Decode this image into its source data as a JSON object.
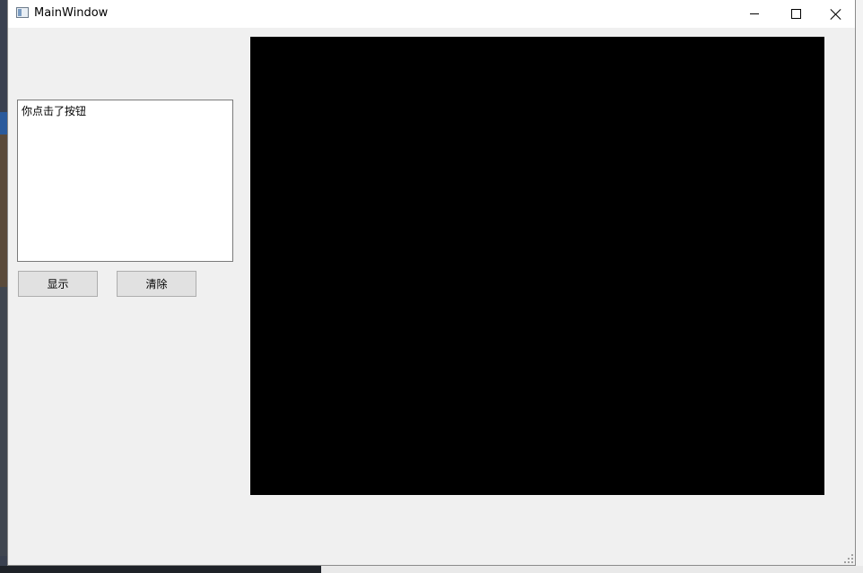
{
  "window": {
    "title": "MainWindow",
    "icon": "app-window-icon"
  },
  "caption_buttons": {
    "minimize": "minimize-icon",
    "maximize": "maximize-icon",
    "close": "close-icon"
  },
  "textbox": {
    "content": "你点击了按钮"
  },
  "buttons": {
    "show_label": "显示",
    "clear_label": "清除"
  },
  "display": {
    "background": "#000000"
  }
}
